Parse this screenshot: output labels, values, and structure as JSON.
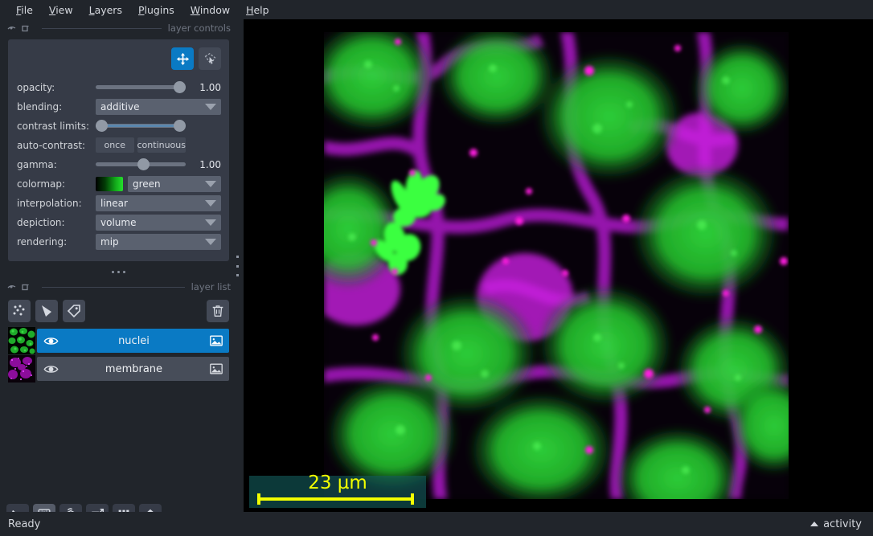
{
  "menu": {
    "items": [
      {
        "label": "File",
        "accel": "F"
      },
      {
        "label": "View",
        "accel": "V"
      },
      {
        "label": "Layers",
        "accel": "L"
      },
      {
        "label": "Plugins",
        "accel": "P"
      },
      {
        "label": "Window",
        "accel": "W"
      },
      {
        "label": "Help",
        "accel": "H"
      }
    ]
  },
  "layer_controls": {
    "dock_title": "layer controls",
    "mode_buttons": [
      {
        "name": "pan-zoom",
        "active": true
      },
      {
        "name": "transform",
        "active": false
      }
    ],
    "opacity": {
      "label": "opacity:",
      "value": "1.00",
      "percent": 100
    },
    "blending": {
      "label": "blending:",
      "value": "additive"
    },
    "contrast_limits": {
      "label": "contrast limits:",
      "low_percent": 0,
      "high_percent": 100
    },
    "auto_contrast": {
      "label": "auto-contrast:",
      "once": "once",
      "continuous": "continuous"
    },
    "gamma": {
      "label": "gamma:",
      "value": "1.00",
      "percent": 48
    },
    "colormap": {
      "label": "colormap:",
      "value": "green",
      "swatch_from": "#000000",
      "swatch_to": "#24e02c"
    },
    "interpolation": {
      "label": "interpolation:",
      "value": "linear"
    },
    "depiction": {
      "label": "depiction:",
      "value": "volume"
    },
    "rendering": {
      "label": "rendering:",
      "value": "mip"
    }
  },
  "layer_list": {
    "dock_title": "layer list",
    "tools": [
      {
        "name": "new-points-layer"
      },
      {
        "name": "new-shapes-layer"
      },
      {
        "name": "new-labels-layer"
      }
    ],
    "delete_tooltip": "delete",
    "layers": [
      {
        "name": "nuclei",
        "selected": true,
        "visible": true,
        "type": "image",
        "thumb": "green"
      },
      {
        "name": "membrane",
        "selected": false,
        "visible": true,
        "type": "image",
        "thumb": "magenta"
      }
    ]
  },
  "viewer_buttons": [
    {
      "name": "console",
      "active": false
    },
    {
      "name": "ndisplay-3d",
      "active": true
    },
    {
      "name": "roll-dims",
      "active": false
    },
    {
      "name": "transpose-dims",
      "active": false
    },
    {
      "name": "grid-view",
      "active": false
    },
    {
      "name": "home",
      "active": false
    }
  ],
  "canvas": {
    "scalebar": {
      "text": "23 µm",
      "color": "#f2ff00",
      "background": "rgba(20,92,92,0.62)"
    }
  },
  "statusbar": {
    "status": "Ready",
    "activity": "activity"
  },
  "theme": {
    "background": "#21252b",
    "panel": "#363b47",
    "accent": "#0a7ac4",
    "control": "#5a616f",
    "text": "#d2d5da",
    "muted": "#6f7581"
  }
}
